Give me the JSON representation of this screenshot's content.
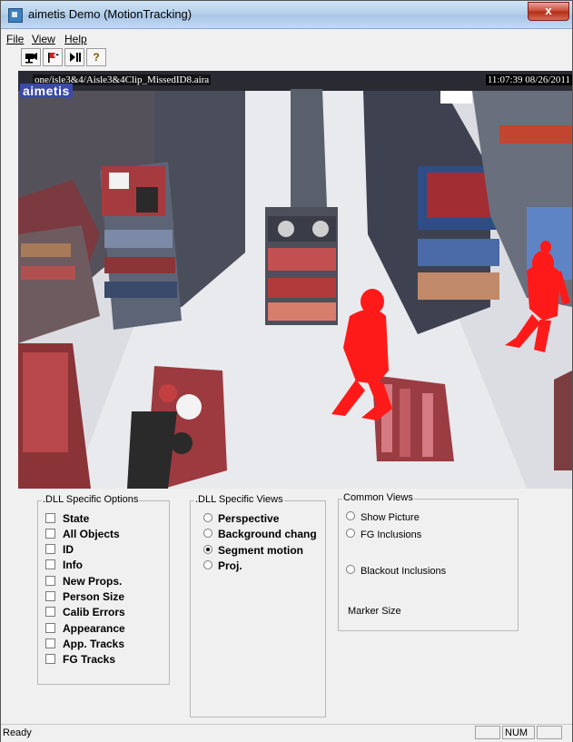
{
  "window": {
    "title": "aimetis Demo (MotionTracking)",
    "close_label": "x"
  },
  "menu": [
    {
      "label": "File"
    },
    {
      "label": "View"
    },
    {
      "label": "Help"
    }
  ],
  "toolbar": {
    "buttons": [
      {
        "icon": "camera-icon"
      },
      {
        "icon": "flag-icon"
      },
      {
        "icon": "play-pause-icon"
      },
      {
        "icon": "help-icon",
        "label": "?"
      }
    ]
  },
  "video": {
    "overlay_filename": "one/isle3&4/Aisle3&4Clip_MissedID8.aira",
    "timestamp": "11:07:39 08/26/2011",
    "logo": "aimetis"
  },
  "dll_options": {
    "legend": ".DLL Specific Options",
    "items": [
      {
        "label": "State",
        "checked": false
      },
      {
        "label": "All Objects",
        "checked": false
      },
      {
        "label": "ID",
        "checked": false
      },
      {
        "label": "Info",
        "checked": false
      },
      {
        "label": "New Props.",
        "checked": false
      },
      {
        "label": "Person Size",
        "checked": false
      },
      {
        "label": "Calib Errors",
        "checked": false
      },
      {
        "label": "Appearance",
        "checked": false
      },
      {
        "label": "App. Tracks",
        "checked": false
      },
      {
        "label": "FG Tracks",
        "checked": false
      }
    ]
  },
  "dll_views": {
    "legend": ".DLL Specific Views",
    "items": [
      {
        "label": "Perspective",
        "selected": false
      },
      {
        "label": "Background chang",
        "selected": false
      },
      {
        "label": "Segment motion",
        "selected": true
      },
      {
        "label": "Proj.",
        "selected": false
      }
    ]
  },
  "common_views": {
    "legend": "Common Views",
    "show_picture": "Show Picture",
    "fg_inclusions": "FG Inclusions",
    "blackout_inclusions": "Blackout Inclusions",
    "marker_size": "Marker Size"
  },
  "status": {
    "text": "Ready",
    "num": "NUM"
  }
}
